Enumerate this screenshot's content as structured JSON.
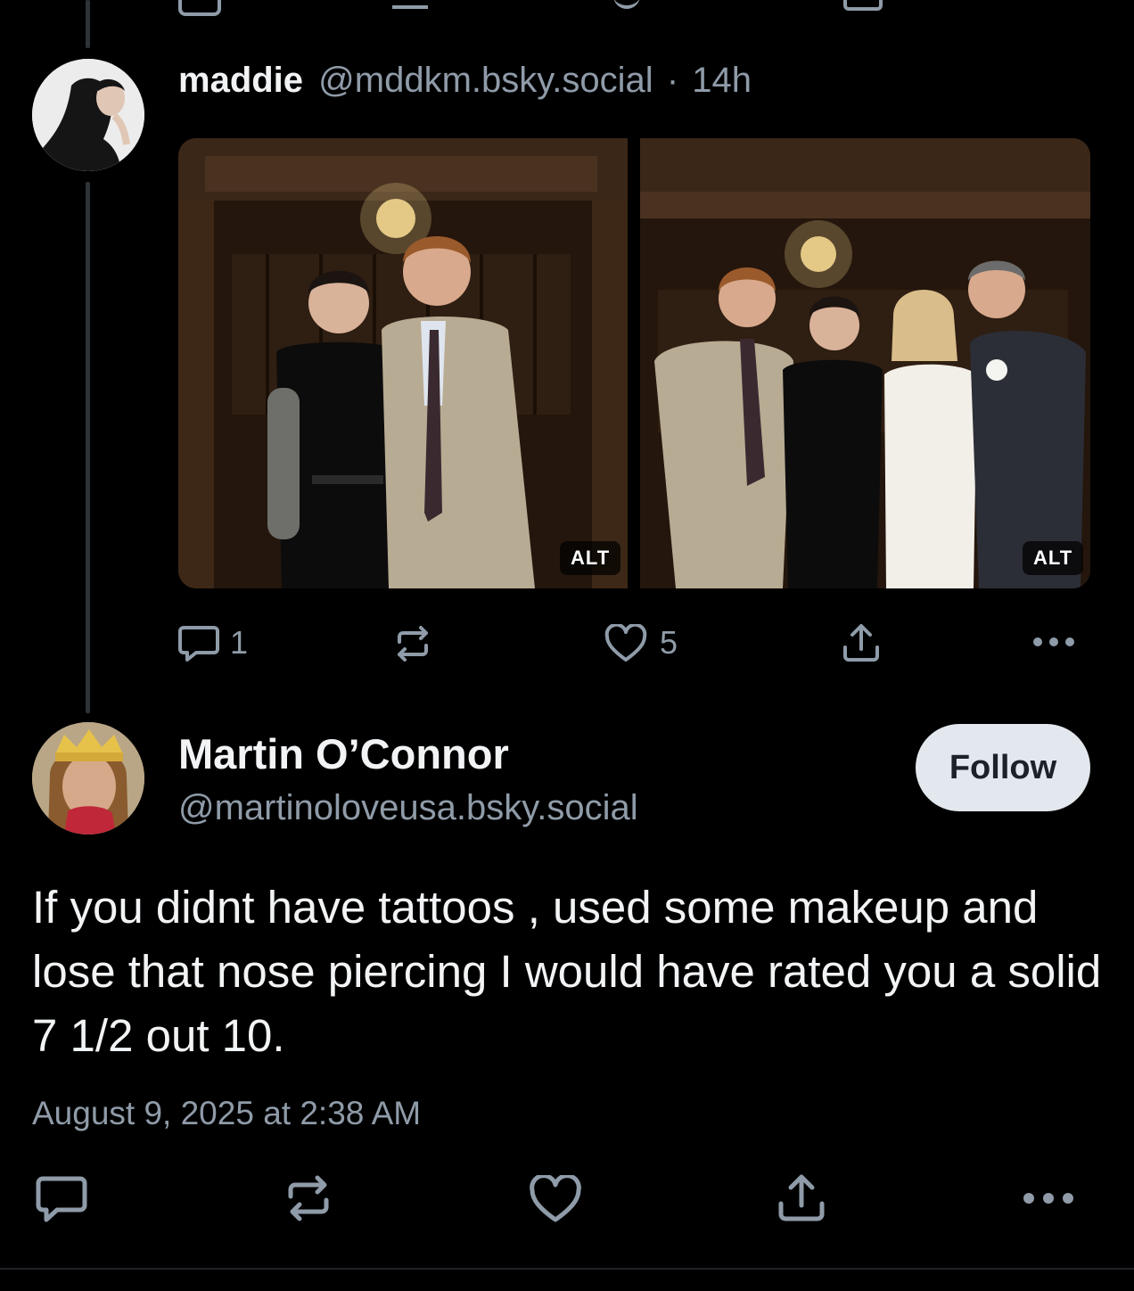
{
  "parent_post": {
    "author_name": "maddie",
    "author_handle": "@mddkm.bsky.social",
    "separator": "·",
    "time": "14h",
    "images": [
      {
        "alt_badge": "ALT"
      },
      {
        "alt_badge": "ALT"
      }
    ],
    "actions": {
      "reply_count": "1",
      "repost_count": "",
      "like_count": "5"
    }
  },
  "reply_post": {
    "author_name": "Martin O’Connor",
    "author_handle": "@martinoloveusa.bsky.social",
    "follow_label": "Follow",
    "text": "If you didnt have tattoos , used some makeup and lose that nose piercing I would have rated you a solid 7 1/2 out 10.",
    "timestamp": "August 9, 2025 at 2:38 AM"
  },
  "colors": {
    "background": "#000000",
    "text": "#f1f3f5",
    "muted": "#8f9ba8",
    "follow_bg": "#e3e8ee",
    "thread_line": "#2e3338"
  },
  "icons": [
    "reply-icon",
    "repost-icon",
    "like-icon",
    "share-icon",
    "more-icon"
  ]
}
